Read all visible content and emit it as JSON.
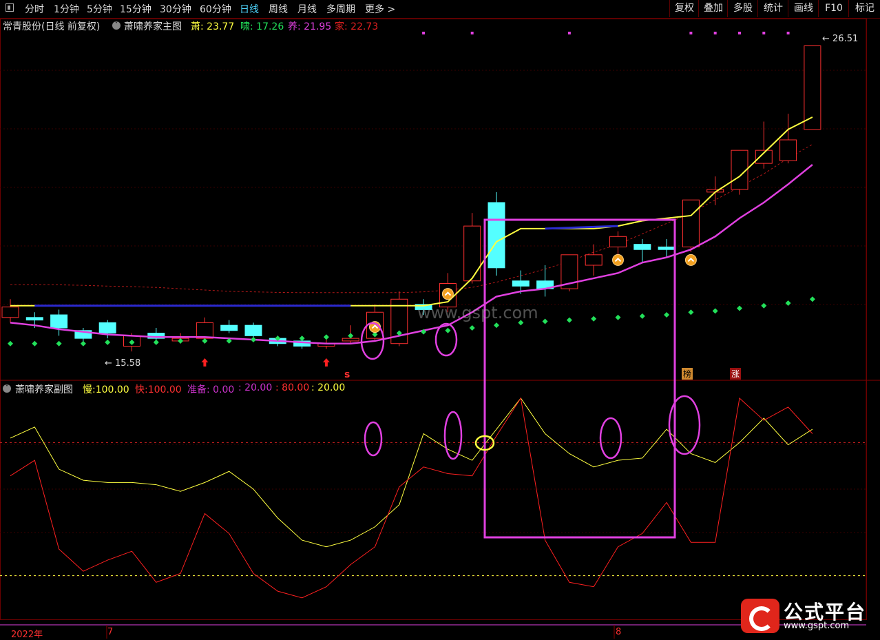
{
  "toolbar": {
    "tabs": [
      "分时",
      "1分钟",
      "5分钟",
      "15分钟",
      "30分钟",
      "60分钟",
      "日线",
      "周线",
      "月线",
      "多周期",
      "更多 >"
    ],
    "active_tab": "日线",
    "right_buttons": [
      "复权",
      "叠加",
      "多股",
      "统计",
      "画线",
      "F10",
      "标记"
    ]
  },
  "main_panel": {
    "stock_title": "常青股份(日线 前复权)",
    "indicator_name": "萧啸养家主图",
    "legend": [
      {
        "name": "萧",
        "value": "23.77",
        "color": "#ffff40"
      },
      {
        "name": "啸",
        "value": "17.26",
        "color": "#22e05a"
      },
      {
        "name": "养",
        "value": "21.95",
        "color": "#e040e0"
      },
      {
        "name": "家",
        "value": "22.73",
        "color": "#e02020"
      }
    ],
    "high_label": "26.51",
    "low_label": "15.58",
    "tags": {
      "s": "s",
      "bang": "榜",
      "zhang": "涨"
    }
  },
  "sub_panel": {
    "indicator_name": "萧啸养家副图",
    "legend": [
      {
        "name": "慢",
        "value": "100.00",
        "color": "#ffff40"
      },
      {
        "name": "快",
        "value": "100.00",
        "color": "#ff3030"
      },
      {
        "name": "准备",
        "value": "0.00",
        "color": "#cc33cc"
      },
      {
        "name": "",
        "value": "20.00",
        "color": "#cc33cc"
      },
      {
        "name": "",
        "value": "80.00",
        "color": "#ff3030"
      },
      {
        "name": "",
        "value": "20.00",
        "color": "#ffff40"
      }
    ]
  },
  "x_axis": {
    "year": "2022年",
    "month_7": "7",
    "month_8": "8"
  },
  "watermark": {
    "site": "www.gspt.com",
    "brand": "公式平台",
    "url": "www.gspt.com"
  },
  "chart_data": {
    "type": "candlestick",
    "title": "常青股份(日线 前复权)",
    "candles": [
      {
        "o": 16.1,
        "c": 16.5,
        "h": 16.8,
        "l": 15.9
      },
      {
        "o": 16.1,
        "c": 16.0,
        "h": 16.3,
        "l": 15.7
      },
      {
        "o": 16.2,
        "c": 15.7,
        "h": 16.4,
        "l": 15.4
      },
      {
        "o": 15.6,
        "c": 15.3,
        "h": 15.7,
        "l": 15.1
      },
      {
        "o": 15.9,
        "c": 15.5,
        "h": 16.0,
        "l": 15.3
      },
      {
        "o": 15.0,
        "c": 15.4,
        "h": 15.5,
        "l": 14.8
      },
      {
        "o": 15.5,
        "c": 15.3,
        "h": 15.7,
        "l": 15.1
      },
      {
        "o": 15.2,
        "c": 15.3,
        "h": 15.5,
        "l": 15.1
      },
      {
        "o": 15.3,
        "c": 15.9,
        "h": 16.1,
        "l": 15.1
      },
      {
        "o": 15.8,
        "c": 15.6,
        "h": 16.0,
        "l": 15.5
      },
      {
        "o": 15.8,
        "c": 15.4,
        "h": 15.9,
        "l": 15.3
      },
      {
        "o": 15.3,
        "c": 15.1,
        "h": 15.4,
        "l": 15.0
      },
      {
        "o": 15.2,
        "c": 15.0,
        "h": 15.3,
        "l": 14.9
      },
      {
        "o": 15.0,
        "c": 15.1,
        "h": 15.4,
        "l": 14.9
      },
      {
        "o": 15.2,
        "c": 15.3,
        "h": 15.8,
        "l": 15.1
      },
      {
        "o": 15.3,
        "c": 16.3,
        "h": 16.6,
        "l": 15.2
      },
      {
        "o": 15.1,
        "c": 16.8,
        "h": 17.1,
        "l": 15.0
      },
      {
        "o": 16.6,
        "c": 16.4,
        "h": 16.8,
        "l": 16.2
      },
      {
        "o": 16.5,
        "c": 17.4,
        "h": 17.8,
        "l": 16.3
      },
      {
        "o": 17.5,
        "c": 19.6,
        "h": 20.1,
        "l": 17.4
      },
      {
        "o": 20.5,
        "c": 18.0,
        "h": 20.9,
        "l": 17.7
      },
      {
        "o": 17.5,
        "c": 17.3,
        "h": 17.9,
        "l": 17.0
      },
      {
        "o": 17.5,
        "c": 17.2,
        "h": 18.1,
        "l": 16.9
      },
      {
        "o": 17.2,
        "c": 18.5,
        "h": 18.5,
        "l": 17.1
      },
      {
        "o": 18.1,
        "c": 18.5,
        "h": 18.9,
        "l": 17.7
      },
      {
        "o": 18.8,
        "c": 19.2,
        "h": 19.4,
        "l": 18.4
      },
      {
        "o": 18.9,
        "c": 18.7,
        "h": 19.1,
        "l": 18.2
      },
      {
        "o": 18.8,
        "c": 18.7,
        "h": 19.1,
        "l": 18.4
      },
      {
        "o": 18.8,
        "c": 20.6,
        "h": 20.6,
        "l": 18.6
      },
      {
        "o": 20.9,
        "c": 21.0,
        "h": 21.5,
        "l": 20.4
      },
      {
        "o": 21.0,
        "c": 22.5,
        "h": 22.5,
        "l": 20.8
      },
      {
        "o": 22.0,
        "c": 22.5,
        "h": 23.6,
        "l": 21.8
      },
      {
        "o": 22.1,
        "c": 22.9,
        "h": 23.9,
        "l": 22.0
      },
      {
        "o": 23.3,
        "c": 26.5,
        "h": 26.5,
        "l": 23.3
      }
    ],
    "xiao_line": [
      16.55,
      16.55,
      16.55,
      16.55,
      16.55,
      16.55,
      16.55,
      16.55,
      16.55,
      16.55,
      16.55,
      16.55,
      16.55,
      16.55,
      16.55,
      16.55,
      16.55,
      16.55,
      16.7,
      17.6,
      19.0,
      19.5,
      19.5,
      19.5,
      19.5,
      19.6,
      19.8,
      19.9,
      20.0,
      20.9,
      21.5,
      22.4,
      23.3,
      23.77
    ],
    "xiao_blue_segments": [
      [
        1,
        14
      ],
      [
        22,
        25
      ]
    ],
    "yang_line": [
      15.9,
      15.8,
      15.65,
      15.55,
      15.45,
      15.4,
      15.35,
      15.35,
      15.35,
      15.3,
      15.25,
      15.2,
      15.15,
      15.1,
      15.1,
      15.2,
      15.4,
      15.6,
      15.8,
      16.3,
      16.9,
      17.1,
      17.2,
      17.4,
      17.6,
      17.8,
      18.2,
      18.4,
      18.7,
      19.2,
      19.9,
      20.5,
      21.2,
      21.95
    ],
    "jia_line": [
      17.35,
      17.35,
      17.35,
      17.33,
      17.3,
      17.28,
      17.25,
      17.2,
      17.15,
      17.1,
      17.08,
      17.06,
      17.05,
      17.05,
      17.05,
      17.05,
      17.05,
      17.08,
      17.15,
      17.25,
      17.45,
      17.7,
      17.95,
      18.25,
      18.6,
      18.9,
      19.3,
      19.7,
      20.1,
      20.6,
      21.1,
      21.6,
      22.2,
      22.73
    ],
    "xiao_dots": [
      15.1,
      15.1,
      15.1,
      15.1,
      15.15,
      15.15,
      15.15,
      15.2,
      15.2,
      15.2,
      15.25,
      15.3,
      15.3,
      15.35,
      15.4,
      15.45,
      15.5,
      15.55,
      15.6,
      15.7,
      15.8,
      15.9,
      15.95,
      16.0,
      16.05,
      16.1,
      16.15,
      16.2,
      16.3,
      16.35,
      16.45,
      16.55,
      16.65,
      16.8
    ],
    "magenta_top_dots": [
      17,
      19,
      23,
      28,
      29,
      30,
      31,
      32
    ],
    "sub_slow": [
      82,
      87,
      68,
      63,
      62,
      62,
      61,
      58,
      62,
      67,
      59,
      46,
      36,
      33,
      36,
      42,
      52,
      84,
      77,
      72,
      86,
      100,
      84,
      75,
      69,
      72,
      73,
      86,
      75,
      71,
      80,
      91,
      79,
      86
    ],
    "sub_fast": [
      65,
      72,
      32,
      22,
      27,
      31,
      17,
      21,
      48,
      39,
      21,
      13,
      10,
      15,
      25,
      33,
      60,
      69,
      66,
      65,
      83,
      100,
      36,
      17,
      15,
      33,
      39,
      53,
      35,
      35,
      100,
      90,
      96,
      84
    ],
    "sub_ref_lines": [
      20,
      80
    ],
    "ylim_main": [
      13.8,
      27.2
    ],
    "ylim_sub": [
      0,
      100
    ]
  }
}
